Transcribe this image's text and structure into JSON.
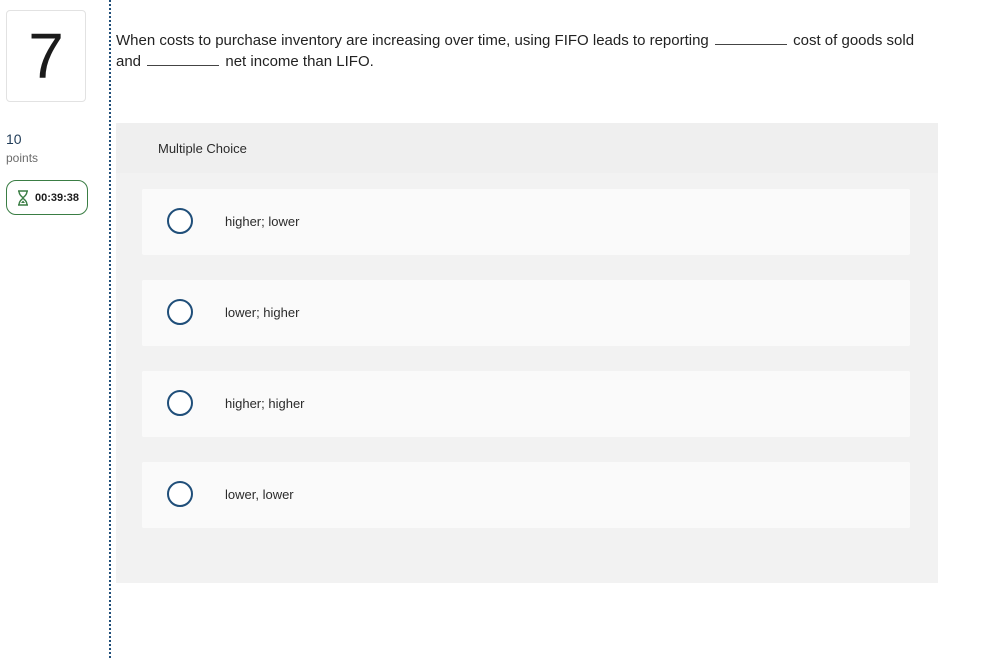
{
  "question": {
    "number": "7",
    "points_value": "10",
    "points_label": "points",
    "timer": "00:39:38",
    "text_part1": "When costs to purchase inventory are increasing over time, using FIFO leads to reporting",
    "text_part2": "cost of goods sold and",
    "text_part3": "net income than LIFO."
  },
  "panel": {
    "header": "Multiple Choice"
  },
  "choices": [
    {
      "label": "higher; lower",
      "selected": false
    },
    {
      "label": "lower; higher",
      "selected": false
    },
    {
      "label": "higher; higher",
      "selected": false
    },
    {
      "label": "lower, lower",
      "selected": false
    }
  ],
  "icons": {
    "timer": "hourglass-icon",
    "choice": "radio-circle"
  },
  "colors": {
    "accent": "#1f4e79",
    "timer_border": "#3a7d44",
    "panel_bg": "#f2f2f2"
  }
}
